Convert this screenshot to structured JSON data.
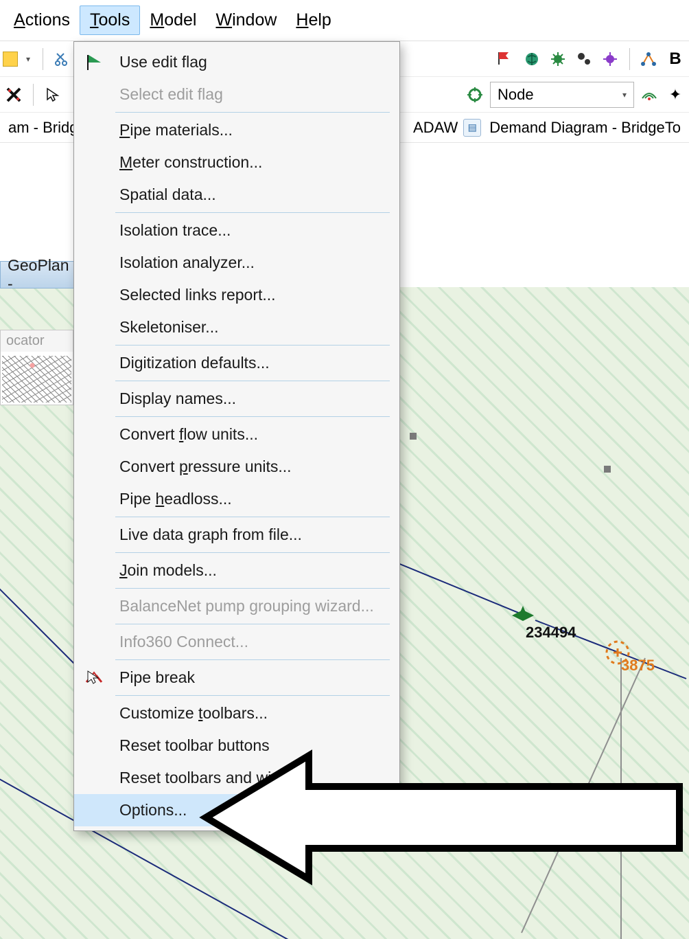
{
  "menubar": {
    "actions": "Actions",
    "tools": "Tools",
    "model": "Model",
    "window": "Window",
    "help": "Help"
  },
  "toolbar": {
    "node_combo": "Node"
  },
  "tabs": {
    "left_partial": "am - Bridge",
    "mid_partial": "ADAW",
    "right_partial": "Demand Diagram - BridgeTo"
  },
  "geoplan": {
    "title_partial": "GeoPlan -"
  },
  "locator": {
    "title": "ocator"
  },
  "map": {
    "label_234494": "234494",
    "label_3875": "3875"
  },
  "tools_menu": {
    "use_edit_flag": "Use edit flag",
    "select_edit_flag": "Select edit flag",
    "pipe_materials": "Pipe materials...",
    "meter_construction": "Meter construction...",
    "spatial_data": "Spatial data...",
    "isolation_trace": "Isolation trace...",
    "isolation_analyzer": "Isolation analyzer...",
    "selected_links_report": "Selected links report...",
    "skeletoniser": "Skeletoniser...",
    "digitization_defaults": "Digitization defaults...",
    "display_names": "Display names...",
    "convert_flow_units": "Convert flow units...",
    "convert_pressure_units": "Convert pressure units...",
    "pipe_headloss": "Pipe headloss...",
    "live_data_graph": "Live data graph from file...",
    "join_models": "Join models...",
    "balancenet": "BalanceNet pump grouping wizard...",
    "info360": "Info360 Connect...",
    "pipe_break": "Pipe break",
    "customize_toolbars": "Customize toolbars...",
    "reset_toolbar_buttons": "Reset toolbar buttons",
    "reset_toolbars_windows_partial": "Reset toolbars and wi",
    "options": "Options..."
  }
}
